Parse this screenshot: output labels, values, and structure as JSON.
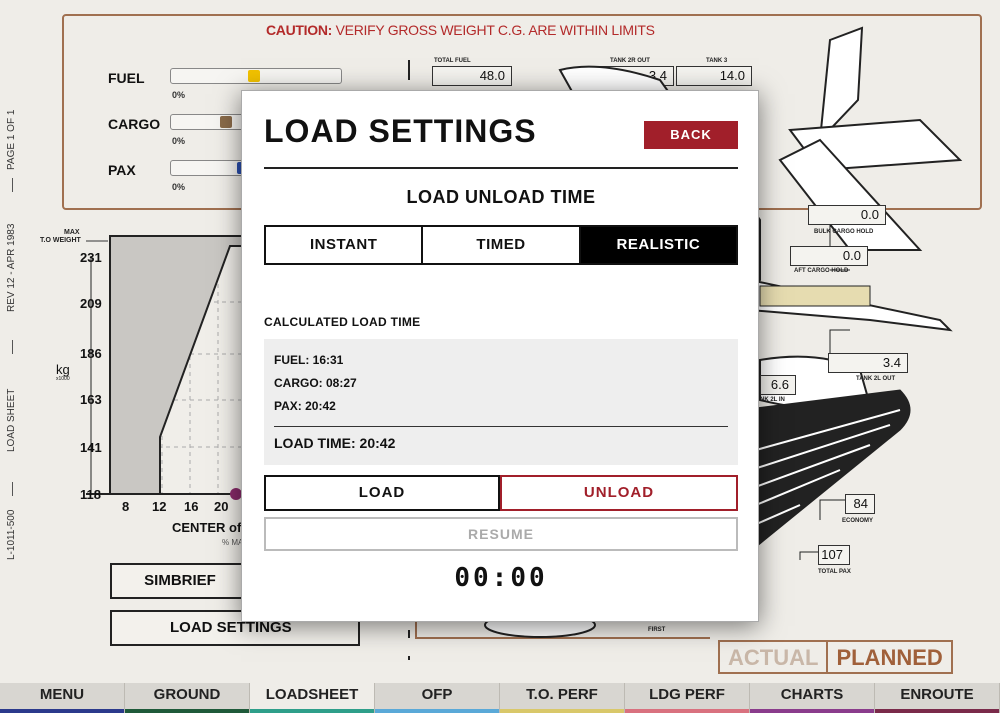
{
  "sidebar_vertical": {
    "page": "PAGE 1 OF 1",
    "rev": "REV 12 - APR 1983",
    "sheet": "LOAD SHEET",
    "model": "L-1011-500"
  },
  "caution": {
    "strong": "CAUTION:",
    "text": " VERIFY GROSS WEIGHT C.G. ARE WITHIN LIMITS"
  },
  "sliders": [
    {
      "label": "FUEL",
      "pct": "0%",
      "color": "#f2c200",
      "fill": 0.49
    },
    {
      "label": "CARGO",
      "pct": "0%",
      "color": "#8a6b4a",
      "fill": 0.31
    },
    {
      "label": "PAX",
      "pct": "0%",
      "color": "#2a4fb0",
      "fill": 0.42
    }
  ],
  "fuel_boxes": {
    "total_fuel_label": "TOTAL FUEL",
    "total_fuel": "48.0",
    "tank2r_label": "TANK 2R OUT",
    "tank2r": "3.4",
    "tank3_label": "TANK 3",
    "tank3": "14.0",
    "bulk_label": "BULK CARGO HOLD",
    "bulk": "0.0",
    "aft_label": "AFT CARGO HOLD",
    "aft": "0.0",
    "tank2l_out_label": "TANK 2L OUT",
    "tank2l_out": "3.4",
    "tank2l_in_label": "NK 2L IN",
    "tank2l_in": "6.6",
    "economy_label": "ECONOMY",
    "economy": "84",
    "total_pax_label": "TOTAL PAX",
    "total_pax": "107",
    "first_label": "FIRST"
  },
  "chart": {
    "max_label": "MAX",
    "tow_label": "T.O WEIGHT",
    "unit": "kg",
    "unit_sub": "x1000",
    "y_ticks": [
      "231",
      "209",
      "186",
      "163",
      "141",
      "118"
    ],
    "x_ticks": [
      "8",
      "12",
      "16",
      "20"
    ],
    "cg_label": "CENTER of",
    "cg_sub": "% MA"
  },
  "left_buttons": {
    "simbrief": "SIMBRIEF",
    "load_settings": "LOAD SETTINGS"
  },
  "actual_planned": {
    "actual": "ACTUAL",
    "planned": "PLANNED"
  },
  "nav": [
    {
      "label": "MENU",
      "color": "#2b3a8c"
    },
    {
      "label": "GROUND",
      "color": "#1f5a3a"
    },
    {
      "label": "LOADSHEET",
      "color": "#2f9f8a"
    },
    {
      "label": "OFP",
      "color": "#5aa9d8"
    },
    {
      "label": "T.O. PERF",
      "color": "#d9c86a"
    },
    {
      "label": "LDG PERF",
      "color": "#d9717f"
    },
    {
      "label": "CHARTS",
      "color": "#8a3c8c"
    },
    {
      "label": "ENROUTE",
      "color": "#7a2a4a"
    }
  ],
  "modal": {
    "title": "LOAD SETTINGS",
    "back": "BACK",
    "subtitle": "LOAD UNLOAD TIME",
    "modes": [
      "INSTANT",
      "TIMED",
      "REALISTIC"
    ],
    "selected_mode": "REALISTIC",
    "calc_label": "CALCULATED LOAD TIME",
    "fuel": "FUEL: 16:31",
    "cargo": "CARGO: 08:27",
    "pax": "PAX: 20:42",
    "total": "LOAD TIME: 20:42",
    "load": "LOAD",
    "unload": "UNLOAD",
    "resume": "RESUME",
    "timer": "00:00"
  }
}
